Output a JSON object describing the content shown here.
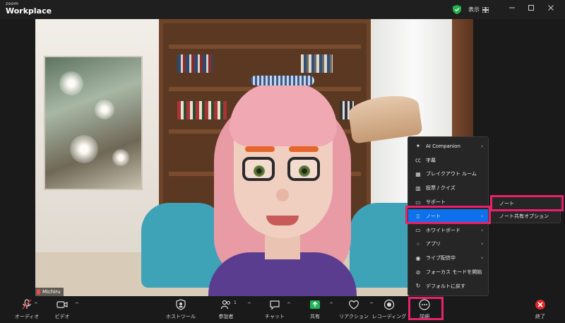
{
  "titlebar": {
    "brand_top": "zoom",
    "brand_main": "Workplace",
    "view_label": "表示"
  },
  "participant": {
    "name": "Michiru"
  },
  "toolbar": {
    "audio": "オーディオ",
    "video": "ビデオ",
    "host_tools": "ホストツール",
    "participants": "参加者",
    "participants_count": "1",
    "chat": "チャット",
    "share": "共有",
    "reactions": "リアクション",
    "recording": "レコーディング",
    "more": "詳細",
    "end": "終了"
  },
  "more_menu": {
    "items": [
      {
        "label": "AI Companion",
        "icon": "ai-companion-icon",
        "has_submenu": true
      },
      {
        "label": "字幕",
        "icon": "captions-icon",
        "has_submenu": false
      },
      {
        "label": "ブレイクアウト ルーム",
        "icon": "breakout-rooms-icon",
        "has_submenu": false
      },
      {
        "label": "投票 / クイズ",
        "icon": "poll-icon",
        "has_submenu": false
      },
      {
        "label": "サポート",
        "icon": "support-icon",
        "has_submenu": false
      },
      {
        "label": "ノート",
        "icon": "notes-icon",
        "has_submenu": true,
        "active": true
      },
      {
        "label": "ホワイトボード",
        "icon": "whiteboard-icon",
        "has_submenu": true
      },
      {
        "label": "アプリ",
        "icon": "apps-icon",
        "has_submenu": true
      },
      {
        "label": "ライブ配信中",
        "icon": "live-stream-icon",
        "has_submenu": true
      },
      {
        "label": "フォーカス モードを開始",
        "icon": "focus-mode-icon",
        "has_submenu": false
      },
      {
        "label": "デフォルトに戻す",
        "icon": "reset-icon",
        "has_submenu": false
      }
    ]
  },
  "notes_submenu": {
    "items": [
      {
        "label": "ノート"
      },
      {
        "label": "ノート共有オプション"
      }
    ]
  },
  "colors": {
    "highlight": "#e8216a",
    "menu_active": "#0e71eb",
    "share_green": "#21b35a",
    "end_red": "#e02828",
    "secure_green": "#22b14c"
  }
}
